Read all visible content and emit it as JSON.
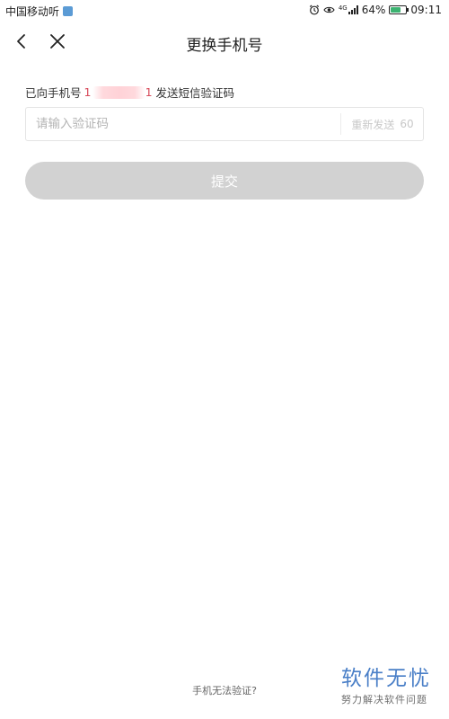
{
  "status_bar": {
    "carrier": "中国移动听",
    "battery_percent": "64%",
    "battery_level": 0.64,
    "network_tag": "4G",
    "time": "09:11",
    "icons": [
      "notification-icon",
      "alarm-icon",
      "eye-icon",
      "signal-icon",
      "battery-icon"
    ]
  },
  "nav": {
    "title": "更换手机号",
    "back_icon": "chevron-left-icon",
    "close_icon": "close-icon"
  },
  "verification": {
    "sent_prefix": "已向手机号",
    "phone_first_digit": "1",
    "phone_last_digit": "1",
    "sent_suffix": "发送短信验证码",
    "code_placeholder": "请输入验证码",
    "resend_label": "重新发送",
    "countdown": "60"
  },
  "submit": {
    "label": "提交"
  },
  "footer": {
    "cannot_verify": "手机无法验证?"
  },
  "watermark": {
    "title": "软件无忧",
    "subtitle": "努力解决软件问题"
  },
  "colors": {
    "submit_disabled": "#d2d2d2",
    "phone_mask": "#ffd2d7",
    "watermark_blue": "#4a7fc7"
  }
}
